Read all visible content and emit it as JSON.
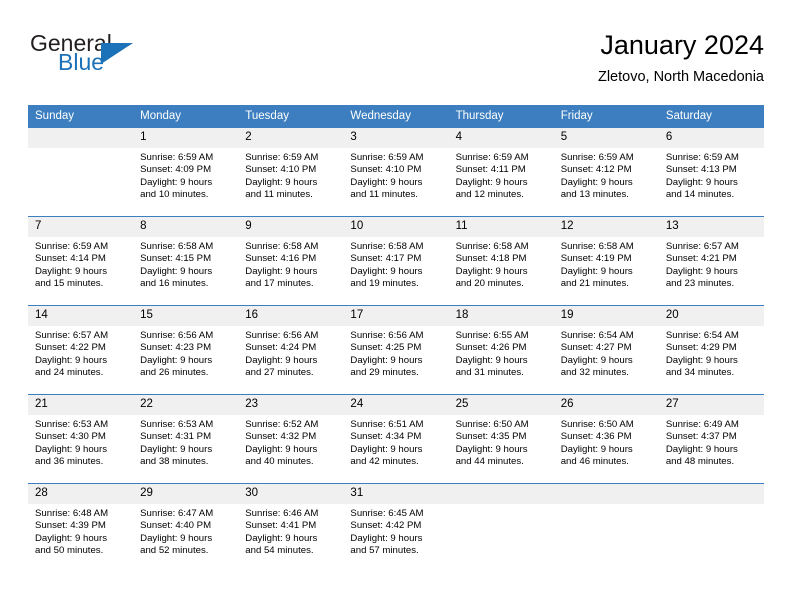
{
  "brand": {
    "name_top": "General",
    "name_bottom": "Blue",
    "accent_color": "#1b72b8"
  },
  "header": {
    "title": "January 2024",
    "subtitle": "Zletovo, North Macedonia"
  },
  "theme": {
    "header_row_bg": "#3c7ebf",
    "daynum_bg": "#f0f0f0",
    "text_color": "#000000"
  },
  "calendar": {
    "weekday_headers": [
      "Sunday",
      "Monday",
      "Tuesday",
      "Wednesday",
      "Thursday",
      "Friday",
      "Saturday"
    ],
    "weeks": [
      [
        {
          "day": "",
          "lines": []
        },
        {
          "day": "1",
          "lines": [
            "Sunrise: 6:59 AM",
            "Sunset: 4:09 PM",
            "Daylight: 9 hours",
            "and 10 minutes."
          ]
        },
        {
          "day": "2",
          "lines": [
            "Sunrise: 6:59 AM",
            "Sunset: 4:10 PM",
            "Daylight: 9 hours",
            "and 11 minutes."
          ]
        },
        {
          "day": "3",
          "lines": [
            "Sunrise: 6:59 AM",
            "Sunset: 4:10 PM",
            "Daylight: 9 hours",
            "and 11 minutes."
          ]
        },
        {
          "day": "4",
          "lines": [
            "Sunrise: 6:59 AM",
            "Sunset: 4:11 PM",
            "Daylight: 9 hours",
            "and 12 minutes."
          ]
        },
        {
          "day": "5",
          "lines": [
            "Sunrise: 6:59 AM",
            "Sunset: 4:12 PM",
            "Daylight: 9 hours",
            "and 13 minutes."
          ]
        },
        {
          "day": "6",
          "lines": [
            "Sunrise: 6:59 AM",
            "Sunset: 4:13 PM",
            "Daylight: 9 hours",
            "and 14 minutes."
          ]
        }
      ],
      [
        {
          "day": "7",
          "lines": [
            "Sunrise: 6:59 AM",
            "Sunset: 4:14 PM",
            "Daylight: 9 hours",
            "and 15 minutes."
          ]
        },
        {
          "day": "8",
          "lines": [
            "Sunrise: 6:58 AM",
            "Sunset: 4:15 PM",
            "Daylight: 9 hours",
            "and 16 minutes."
          ]
        },
        {
          "day": "9",
          "lines": [
            "Sunrise: 6:58 AM",
            "Sunset: 4:16 PM",
            "Daylight: 9 hours",
            "and 17 minutes."
          ]
        },
        {
          "day": "10",
          "lines": [
            "Sunrise: 6:58 AM",
            "Sunset: 4:17 PM",
            "Daylight: 9 hours",
            "and 19 minutes."
          ]
        },
        {
          "day": "11",
          "lines": [
            "Sunrise: 6:58 AM",
            "Sunset: 4:18 PM",
            "Daylight: 9 hours",
            "and 20 minutes."
          ]
        },
        {
          "day": "12",
          "lines": [
            "Sunrise: 6:58 AM",
            "Sunset: 4:19 PM",
            "Daylight: 9 hours",
            "and 21 minutes."
          ]
        },
        {
          "day": "13",
          "lines": [
            "Sunrise: 6:57 AM",
            "Sunset: 4:21 PM",
            "Daylight: 9 hours",
            "and 23 minutes."
          ]
        }
      ],
      [
        {
          "day": "14",
          "lines": [
            "Sunrise: 6:57 AM",
            "Sunset: 4:22 PM",
            "Daylight: 9 hours",
            "and 24 minutes."
          ]
        },
        {
          "day": "15",
          "lines": [
            "Sunrise: 6:56 AM",
            "Sunset: 4:23 PM",
            "Daylight: 9 hours",
            "and 26 minutes."
          ]
        },
        {
          "day": "16",
          "lines": [
            "Sunrise: 6:56 AM",
            "Sunset: 4:24 PM",
            "Daylight: 9 hours",
            "and 27 minutes."
          ]
        },
        {
          "day": "17",
          "lines": [
            "Sunrise: 6:56 AM",
            "Sunset: 4:25 PM",
            "Daylight: 9 hours",
            "and 29 minutes."
          ]
        },
        {
          "day": "18",
          "lines": [
            "Sunrise: 6:55 AM",
            "Sunset: 4:26 PM",
            "Daylight: 9 hours",
            "and 31 minutes."
          ]
        },
        {
          "day": "19",
          "lines": [
            "Sunrise: 6:54 AM",
            "Sunset: 4:27 PM",
            "Daylight: 9 hours",
            "and 32 minutes."
          ]
        },
        {
          "day": "20",
          "lines": [
            "Sunrise: 6:54 AM",
            "Sunset: 4:29 PM",
            "Daylight: 9 hours",
            "and 34 minutes."
          ]
        }
      ],
      [
        {
          "day": "21",
          "lines": [
            "Sunrise: 6:53 AM",
            "Sunset: 4:30 PM",
            "Daylight: 9 hours",
            "and 36 minutes."
          ]
        },
        {
          "day": "22",
          "lines": [
            "Sunrise: 6:53 AM",
            "Sunset: 4:31 PM",
            "Daylight: 9 hours",
            "and 38 minutes."
          ]
        },
        {
          "day": "23",
          "lines": [
            "Sunrise: 6:52 AM",
            "Sunset: 4:32 PM",
            "Daylight: 9 hours",
            "and 40 minutes."
          ]
        },
        {
          "day": "24",
          "lines": [
            "Sunrise: 6:51 AM",
            "Sunset: 4:34 PM",
            "Daylight: 9 hours",
            "and 42 minutes."
          ]
        },
        {
          "day": "25",
          "lines": [
            "Sunrise: 6:50 AM",
            "Sunset: 4:35 PM",
            "Daylight: 9 hours",
            "and 44 minutes."
          ]
        },
        {
          "day": "26",
          "lines": [
            "Sunrise: 6:50 AM",
            "Sunset: 4:36 PM",
            "Daylight: 9 hours",
            "and 46 minutes."
          ]
        },
        {
          "day": "27",
          "lines": [
            "Sunrise: 6:49 AM",
            "Sunset: 4:37 PM",
            "Daylight: 9 hours",
            "and 48 minutes."
          ]
        }
      ],
      [
        {
          "day": "28",
          "lines": [
            "Sunrise: 6:48 AM",
            "Sunset: 4:39 PM",
            "Daylight: 9 hours",
            "and 50 minutes."
          ]
        },
        {
          "day": "29",
          "lines": [
            "Sunrise: 6:47 AM",
            "Sunset: 4:40 PM",
            "Daylight: 9 hours",
            "and 52 minutes."
          ]
        },
        {
          "day": "30",
          "lines": [
            "Sunrise: 6:46 AM",
            "Sunset: 4:41 PM",
            "Daylight: 9 hours",
            "and 54 minutes."
          ]
        },
        {
          "day": "31",
          "lines": [
            "Sunrise: 6:45 AM",
            "Sunset: 4:42 PM",
            "Daylight: 9 hours",
            "and 57 minutes."
          ]
        },
        {
          "day": "",
          "lines": []
        },
        {
          "day": "",
          "lines": []
        },
        {
          "day": "",
          "lines": []
        }
      ]
    ]
  }
}
